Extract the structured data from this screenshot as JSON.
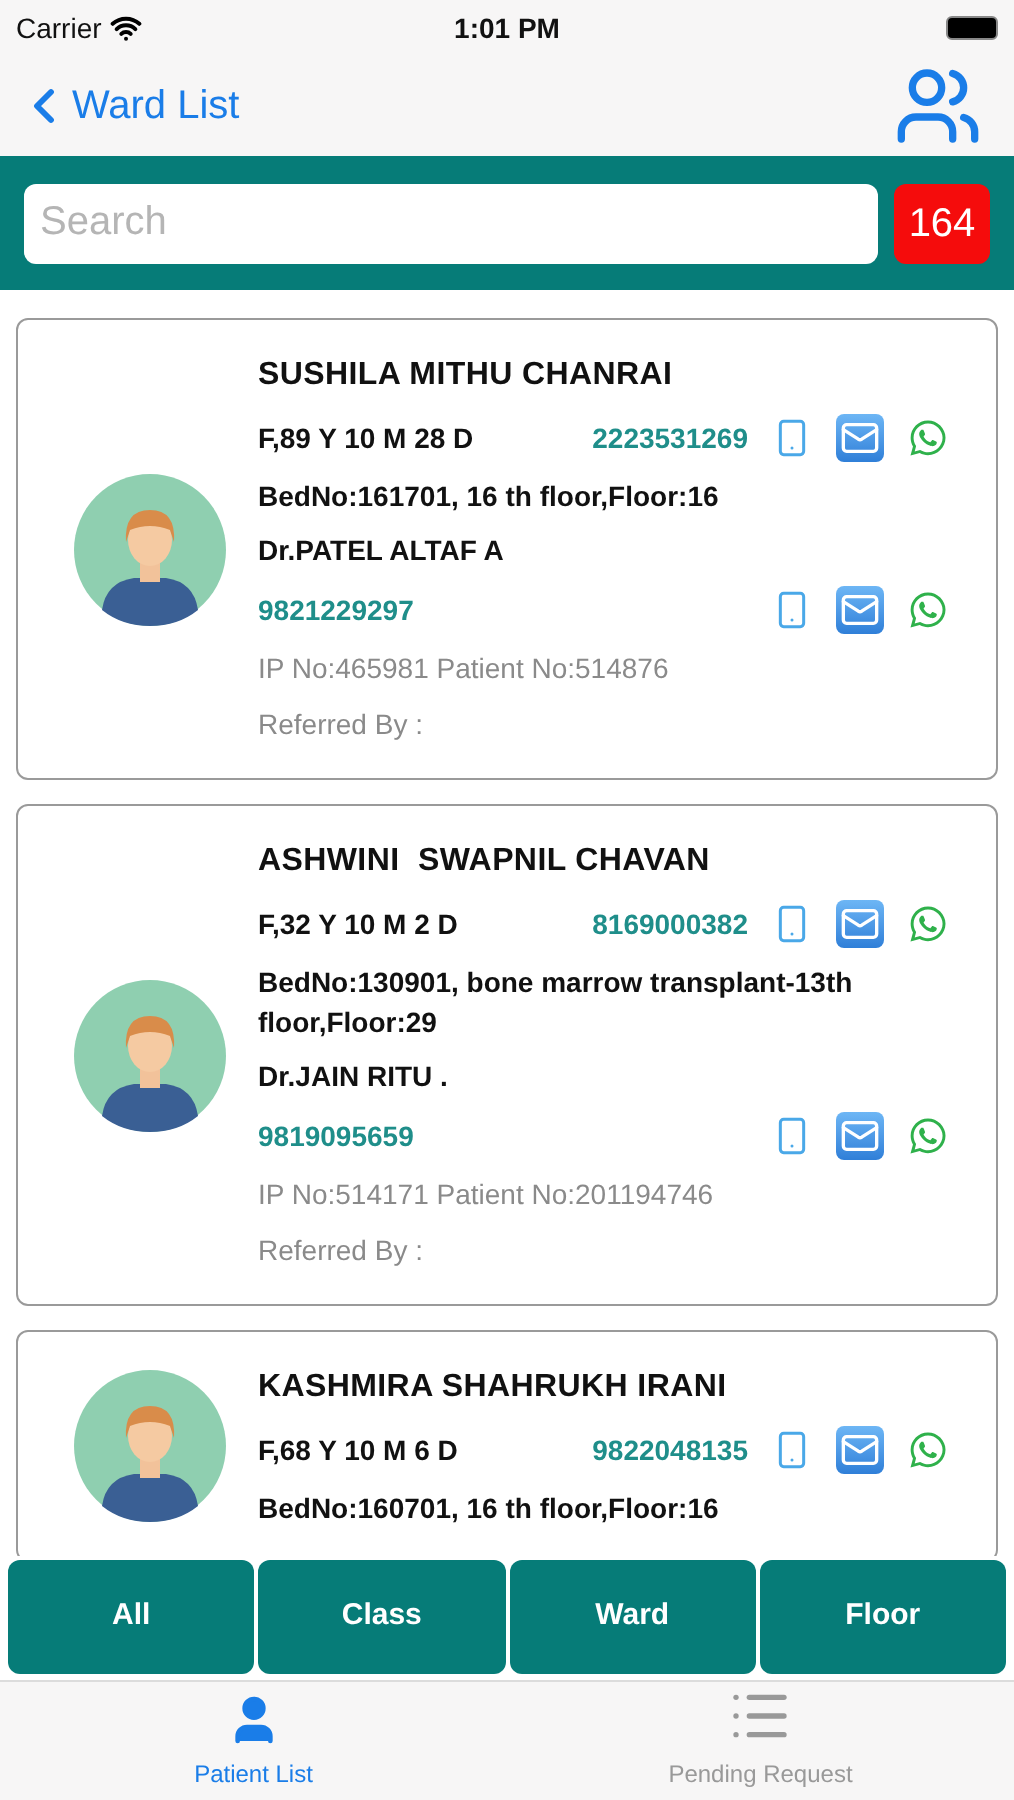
{
  "status_bar": {
    "carrier": "Carrier",
    "time": "1:01 PM"
  },
  "nav": {
    "back_label": "Ward List"
  },
  "search": {
    "placeholder": "Search",
    "count": "164"
  },
  "patients": [
    {
      "name": "SUSHILA MITHU CHANRAI",
      "age": "F,89 Y 10 M 28 D",
      "phone": "2223531269",
      "bed": "BedNo:161701, 16 th floor,Floor:16",
      "doctor": "Dr.PATEL ALTAF A",
      "doctor_phone": "9821229297",
      "ids": "IP No:465981 Patient No:514876",
      "referred": "Referred By :"
    },
    {
      "name": "ASHWINI  SWAPNIL CHAVAN",
      "age": "F,32 Y 10 M 2 D",
      "phone": "8169000382",
      "bed": "BedNo:130901, bone marrow transplant-13th floor,Floor:29",
      "doctor": "Dr.JAIN RITU .",
      "doctor_phone": "9819095659",
      "ids": "IP No:514171 Patient No:201194746",
      "referred": "Referred By :"
    },
    {
      "name": "KASHMIRA SHAHRUKH IRANI",
      "age": "F,68 Y 10 M 6 D",
      "phone": "9822048135",
      "bed": "BedNo:160701, 16 th floor,Floor:16"
    }
  ],
  "filters": [
    "All",
    "Class",
    "Ward",
    "Floor"
  ],
  "tabs": [
    {
      "label": "Patient List",
      "kind": "person",
      "selected": true
    },
    {
      "label": "Pending Request",
      "kind": "list",
      "selected": false
    }
  ]
}
